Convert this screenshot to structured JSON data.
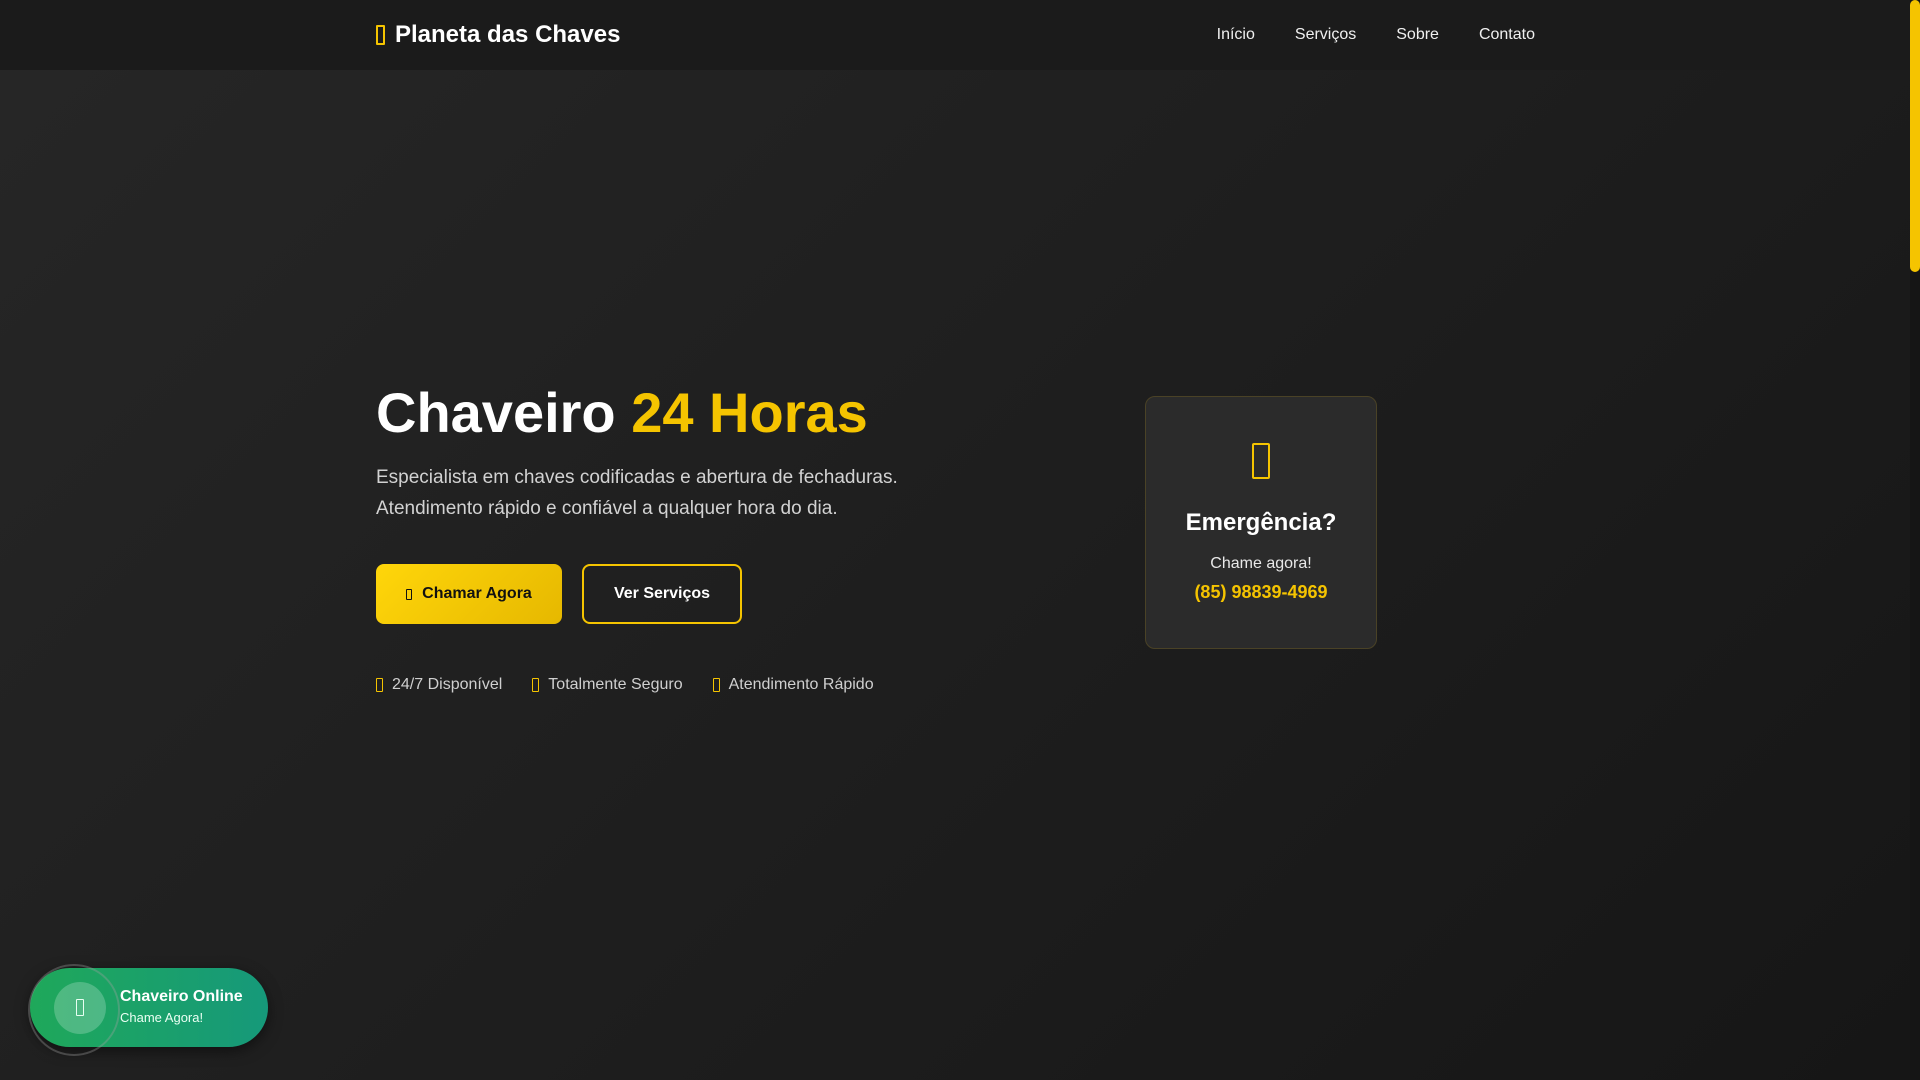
{
  "header": {
    "brand_name": "Planeta das Chaves",
    "brand_icon": "key-icon",
    "nav": [
      "Início",
      "Serviços",
      "Sobre",
      "Contato"
    ]
  },
  "hero": {
    "title_main": "Chaveiro",
    "title_accent": "24 Horas",
    "subtitle_line1": "Especialista em chaves codificadas e abertura de fechaduras.",
    "subtitle_line2": "Atendimento rápido e confiável a qualquer hora do dia.",
    "primary_button": "Chamar Agora",
    "secondary_button": "Ver Serviços",
    "features": [
      "24/7 Disponível",
      "Totalmente Seguro",
      "Atendimento Rápido"
    ]
  },
  "emergency_card": {
    "title": "Emergência?",
    "subtitle": "Chame agora!",
    "phone": "(85) 98839-4969"
  },
  "chat_widget": {
    "title": "Chaveiro Online",
    "subtitle": "Chame Agora!"
  },
  "colors": {
    "accent": "#f5c400",
    "background": "#1a1a1a",
    "chat_green": "#1fa85a"
  }
}
